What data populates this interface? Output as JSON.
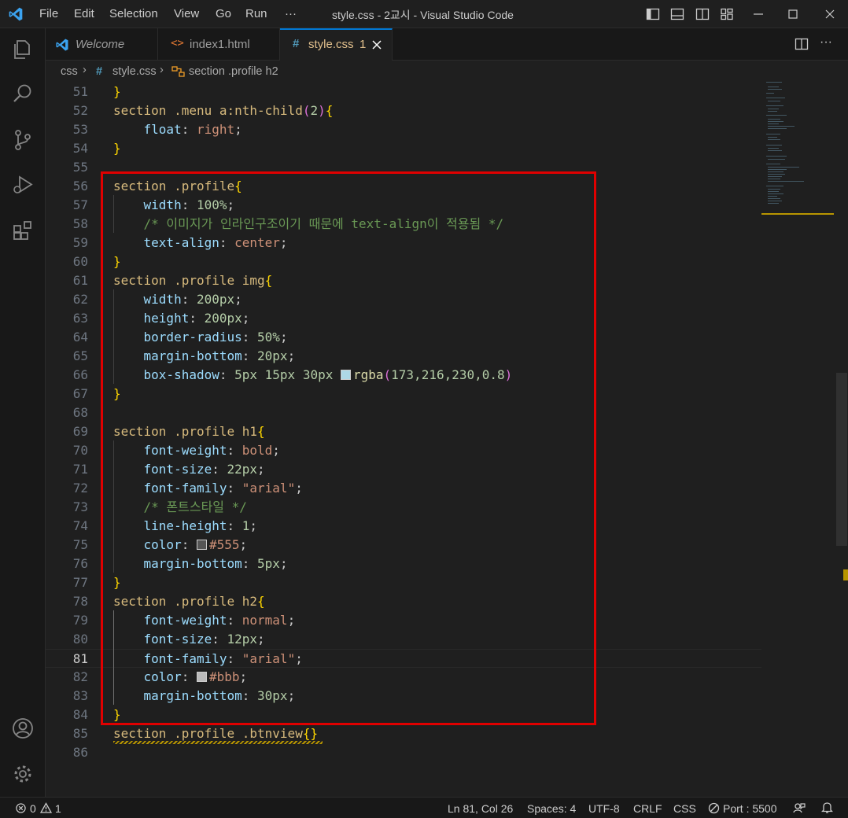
{
  "window": {
    "title": "style.css - 2교시 - Visual Studio Code",
    "menu": [
      "File",
      "Edit",
      "Selection",
      "View",
      "Go",
      "Run",
      "···"
    ]
  },
  "tabs": [
    {
      "label": "Welcome",
      "icon": "vscode-logo-icon",
      "active": false
    },
    {
      "label": "index1.html",
      "icon": "html-file-icon",
      "active": false
    },
    {
      "label": "style.css",
      "icon": "css-file-icon",
      "active": true,
      "badge": "1"
    }
  ],
  "breadcrumb": {
    "folder": "css",
    "file": "style.css",
    "symbol": "section .profile h2"
  },
  "colors": {
    "accent": "#0078d4",
    "highlight_box": "#e00000",
    "swatch_rgba": "#add8e6",
    "swatch_555": "#555555",
    "swatch_bbb": "#bbbbbb"
  },
  "editor": {
    "lines": [
      {
        "n": "51",
        "tokens": [
          [
            "br",
            "}"
          ]
        ]
      },
      {
        "n": "52",
        "tokens": [
          [
            "sel",
            "section .menu a:nth-child"
          ],
          [
            "br2",
            "("
          ],
          [
            "num-v",
            "2"
          ],
          [
            "br2",
            ")"
          ],
          [
            "br",
            "{"
          ]
        ]
      },
      {
        "n": "53",
        "tokens": [
          [
            "plain",
            "    "
          ],
          [
            "prop",
            "float"
          ],
          [
            "plain",
            ": "
          ],
          [
            "val",
            "right"
          ],
          [
            "plain",
            ";"
          ]
        ]
      },
      {
        "n": "54",
        "tokens": [
          [
            "br",
            "}"
          ]
        ]
      },
      {
        "n": "55",
        "tokens": []
      },
      {
        "n": "56",
        "tokens": [
          [
            "sel",
            "section .profile"
          ],
          [
            "br",
            "{"
          ]
        ]
      },
      {
        "n": "57",
        "tokens": [
          [
            "plain",
            "    "
          ],
          [
            "prop",
            "width"
          ],
          [
            "plain",
            ": "
          ],
          [
            "num-v",
            "100%"
          ],
          [
            "plain",
            ";"
          ]
        ]
      },
      {
        "n": "58",
        "tokens": [
          [
            "plain",
            "    "
          ],
          [
            "com",
            "/* 이미지가 인라인구조이기 때문에 text-align이 적용됨 */"
          ]
        ]
      },
      {
        "n": "59",
        "tokens": [
          [
            "plain",
            "    "
          ],
          [
            "prop",
            "text-align"
          ],
          [
            "plain",
            ": "
          ],
          [
            "val",
            "center"
          ],
          [
            "plain",
            ";"
          ]
        ]
      },
      {
        "n": "60",
        "tokens": [
          [
            "br",
            "}"
          ]
        ]
      },
      {
        "n": "61",
        "tokens": [
          [
            "sel",
            "section .profile img"
          ],
          [
            "br",
            "{"
          ]
        ]
      },
      {
        "n": "62",
        "tokens": [
          [
            "plain",
            "    "
          ],
          [
            "prop",
            "width"
          ],
          [
            "plain",
            ": "
          ],
          [
            "num-v",
            "200px"
          ],
          [
            "plain",
            ";"
          ]
        ]
      },
      {
        "n": "63",
        "tokens": [
          [
            "plain",
            "    "
          ],
          [
            "prop",
            "height"
          ],
          [
            "plain",
            ": "
          ],
          [
            "num-v",
            "200px"
          ],
          [
            "plain",
            ";"
          ]
        ]
      },
      {
        "n": "64",
        "tokens": [
          [
            "plain",
            "    "
          ],
          [
            "prop",
            "border-radius"
          ],
          [
            "plain",
            ": "
          ],
          [
            "num-v",
            "50%"
          ],
          [
            "plain",
            ";"
          ]
        ]
      },
      {
        "n": "65",
        "tokens": [
          [
            "plain",
            "    "
          ],
          [
            "prop",
            "margin-bottom"
          ],
          [
            "plain",
            ": "
          ],
          [
            "num-v",
            "20px"
          ],
          [
            "plain",
            ";"
          ]
        ]
      },
      {
        "n": "66",
        "tokens": [
          [
            "plain",
            "    "
          ],
          [
            "prop",
            "box-shadow"
          ],
          [
            "plain",
            ": "
          ],
          [
            "num-v",
            "5px 15px 30px "
          ],
          [
            "swatch",
            "#add8e6"
          ],
          [
            "fn",
            "rgba"
          ],
          [
            "br2",
            "("
          ],
          [
            "num-v",
            "173,216,230,0.8"
          ],
          [
            "br2",
            ")"
          ]
        ]
      },
      {
        "n": "67",
        "tokens": [
          [
            "br",
            "}"
          ]
        ]
      },
      {
        "n": "68",
        "tokens": []
      },
      {
        "n": "69",
        "tokens": [
          [
            "sel",
            "section .profile h1"
          ],
          [
            "br",
            "{"
          ]
        ]
      },
      {
        "n": "70",
        "tokens": [
          [
            "plain",
            "    "
          ],
          [
            "prop",
            "font-weight"
          ],
          [
            "plain",
            ": "
          ],
          [
            "val",
            "bold"
          ],
          [
            "plain",
            ";"
          ]
        ]
      },
      {
        "n": "71",
        "tokens": [
          [
            "plain",
            "    "
          ],
          [
            "prop",
            "font-size"
          ],
          [
            "plain",
            ": "
          ],
          [
            "num-v",
            "22px"
          ],
          [
            "plain",
            ";"
          ]
        ]
      },
      {
        "n": "72",
        "tokens": [
          [
            "plain",
            "    "
          ],
          [
            "prop",
            "font-family"
          ],
          [
            "plain",
            ": "
          ],
          [
            "val",
            "\"arial\""
          ],
          [
            "plain",
            ";"
          ]
        ]
      },
      {
        "n": "73",
        "tokens": [
          [
            "plain",
            "    "
          ],
          [
            "com",
            "/* 폰트스타일 */"
          ]
        ]
      },
      {
        "n": "74",
        "tokens": [
          [
            "plain",
            "    "
          ],
          [
            "prop",
            "line-height"
          ],
          [
            "plain",
            ": "
          ],
          [
            "num-v",
            "1"
          ],
          [
            "plain",
            ";"
          ]
        ]
      },
      {
        "n": "75",
        "tokens": [
          [
            "plain",
            "    "
          ],
          [
            "prop",
            "color"
          ],
          [
            "plain",
            ": "
          ],
          [
            "swatch",
            "#555555"
          ],
          [
            "val",
            "#555"
          ],
          [
            "plain",
            ";"
          ]
        ]
      },
      {
        "n": "76",
        "tokens": [
          [
            "plain",
            "    "
          ],
          [
            "prop",
            "margin-bottom"
          ],
          [
            "plain",
            ": "
          ],
          [
            "num-v",
            "5px"
          ],
          [
            "plain",
            ";"
          ]
        ]
      },
      {
        "n": "77",
        "tokens": [
          [
            "br",
            "}"
          ]
        ]
      },
      {
        "n": "78",
        "tokens": [
          [
            "sel",
            "section .profile h2"
          ],
          [
            "br",
            "{"
          ]
        ]
      },
      {
        "n": "79",
        "tokens": [
          [
            "plain",
            "    "
          ],
          [
            "prop",
            "font-weight"
          ],
          [
            "plain",
            ": "
          ],
          [
            "val",
            "normal"
          ],
          [
            "plain",
            ";"
          ]
        ]
      },
      {
        "n": "80",
        "tokens": [
          [
            "plain",
            "    "
          ],
          [
            "prop",
            "font-size"
          ],
          [
            "plain",
            ": "
          ],
          [
            "num-v",
            "12px"
          ],
          [
            "plain",
            ";"
          ]
        ]
      },
      {
        "n": "81",
        "tokens": [
          [
            "plain",
            "    "
          ],
          [
            "prop",
            "font-family"
          ],
          [
            "plain",
            ": "
          ],
          [
            "val",
            "\"arial\""
          ],
          [
            "plain",
            ";"
          ]
        ]
      },
      {
        "n": "82",
        "tokens": [
          [
            "plain",
            "    "
          ],
          [
            "prop",
            "color"
          ],
          [
            "plain",
            ": "
          ],
          [
            "swatch",
            "#bbbbbb"
          ],
          [
            "val",
            "#bbb"
          ],
          [
            "plain",
            ";"
          ]
        ]
      },
      {
        "n": "83",
        "tokens": [
          [
            "plain",
            "    "
          ],
          [
            "prop",
            "margin-bottom"
          ],
          [
            "plain",
            ": "
          ],
          [
            "num-v",
            "30px"
          ],
          [
            "plain",
            ";"
          ]
        ]
      },
      {
        "n": "84",
        "tokens": [
          [
            "br",
            "}"
          ]
        ]
      },
      {
        "n": "85",
        "tokens": [
          [
            "sel",
            "section .profile .btnview"
          ],
          [
            "br",
            "{}"
          ]
        ]
      },
      {
        "n": "86",
        "tokens": []
      }
    ],
    "current_line": "81"
  },
  "status": {
    "errors": "0",
    "warnings": "1",
    "position": "Ln 81, Col 26",
    "spaces": "Spaces: 4",
    "encoding": "UTF-8",
    "eol": "CRLF",
    "language": "CSS",
    "port": "Port : 5500"
  }
}
